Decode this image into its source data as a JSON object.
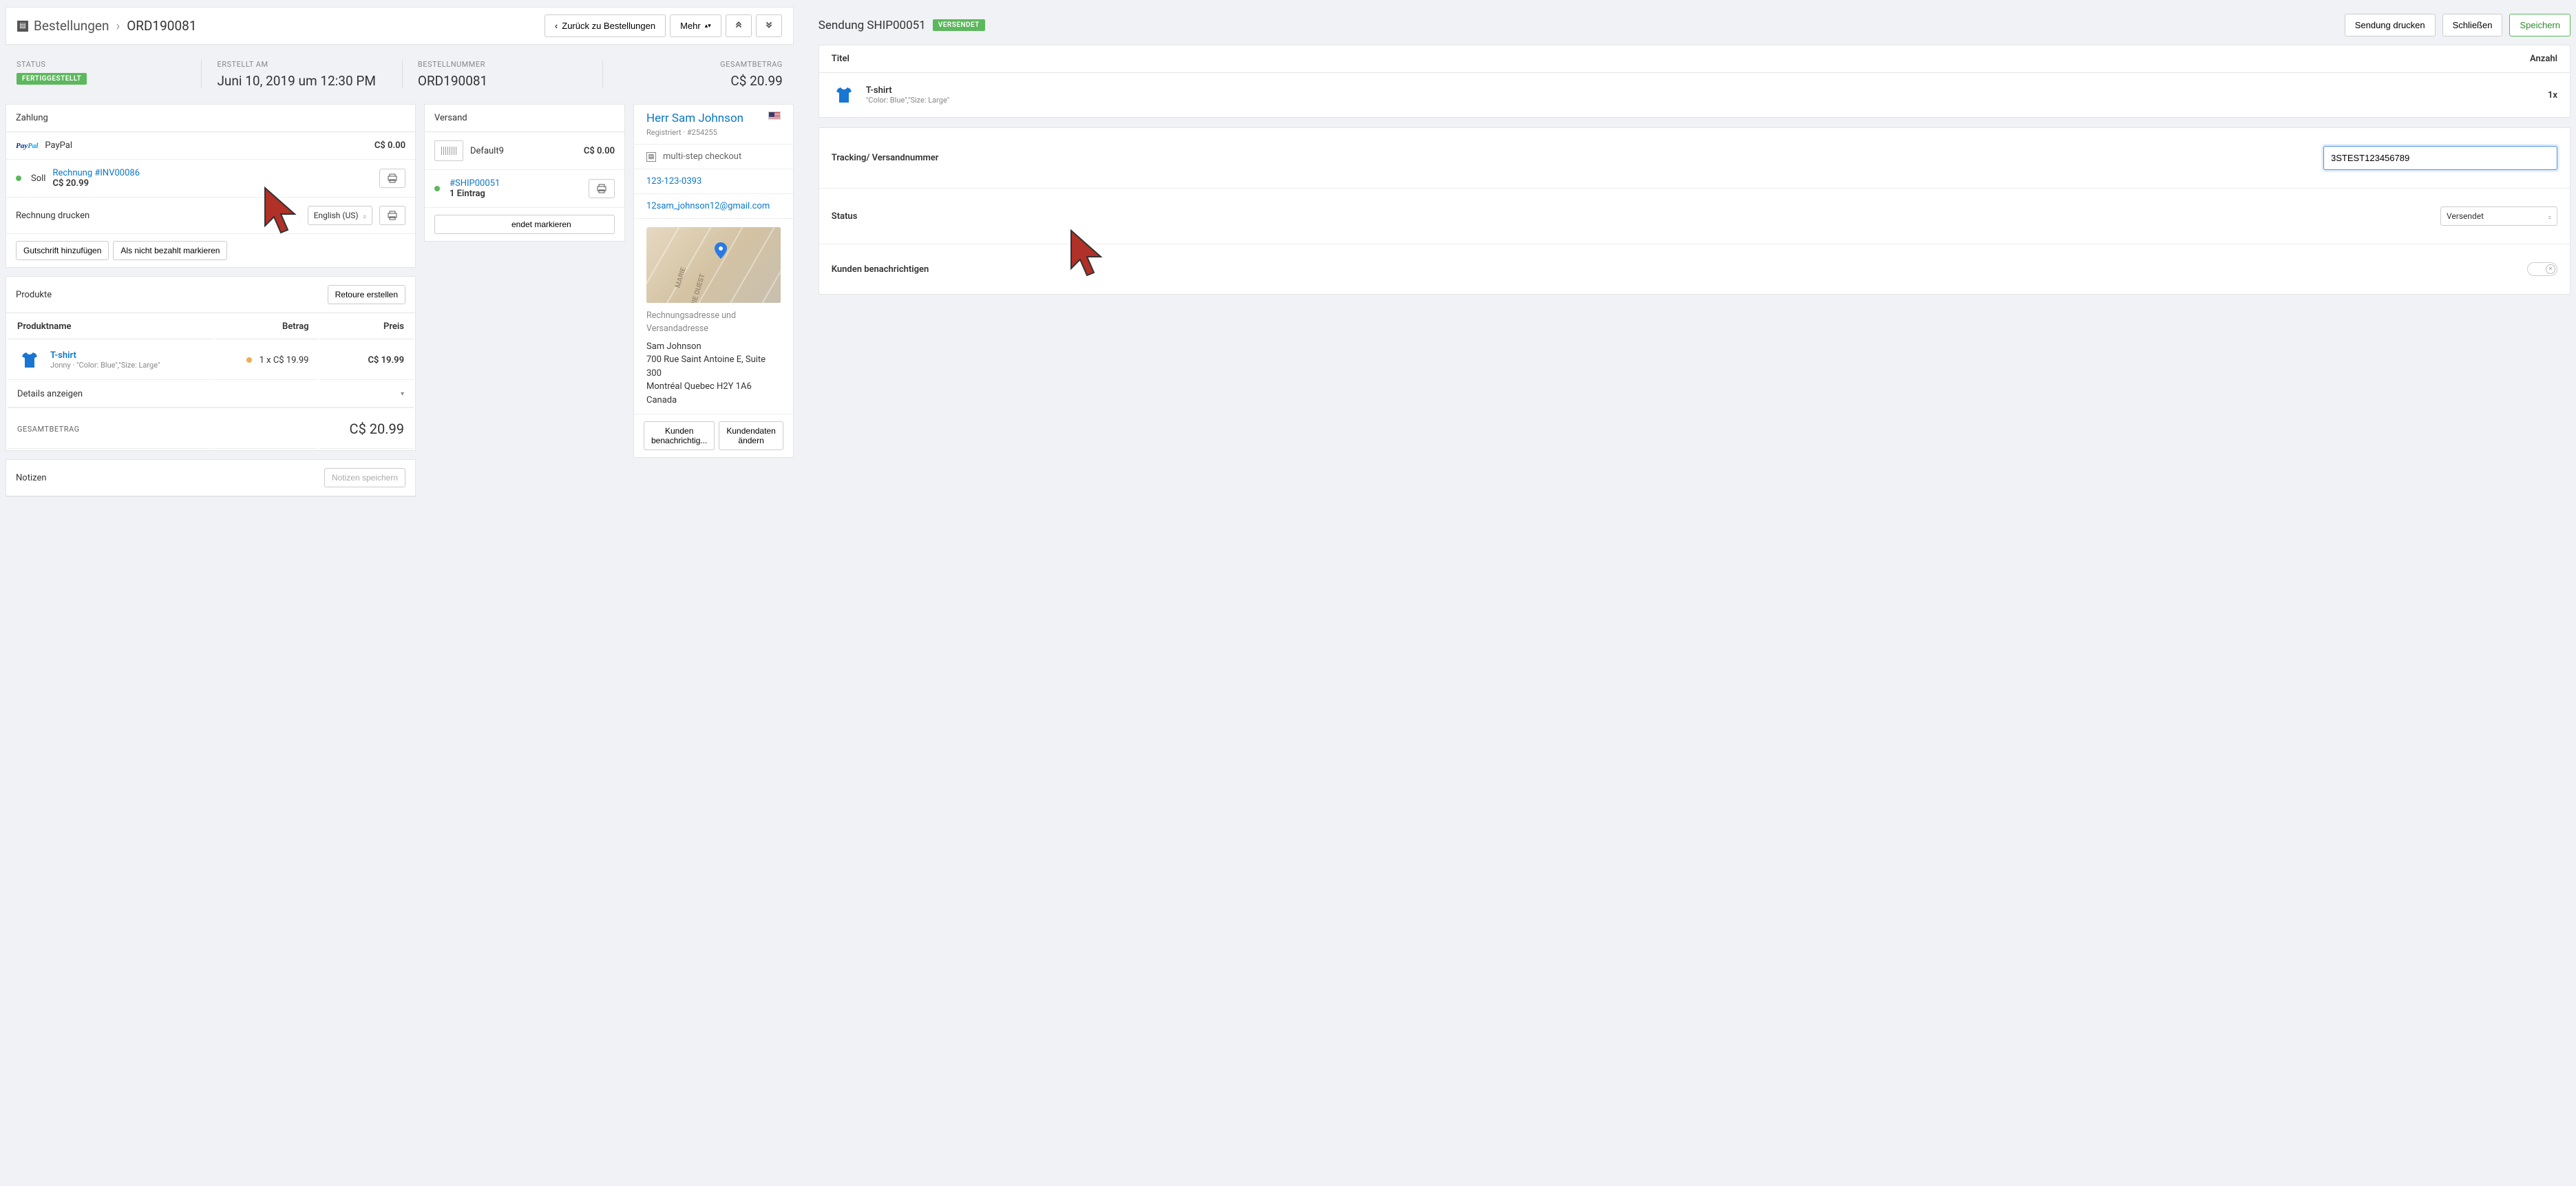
{
  "breadcrumb": {
    "root": "Bestellungen",
    "current": "ORD190081"
  },
  "header_actions": {
    "back": "Zurück zu Bestellungen",
    "more": "Mehr"
  },
  "summary": {
    "status_label": "STATUS",
    "status_badge": "FERTIGGESTELLT",
    "created_label": "ERSTELLT AM",
    "created_value": "Juni 10, 2019 um 12:30 PM",
    "ordernum_label": "BESTELLNUMMER",
    "ordernum_value": "ORD190081",
    "total_label": "GESAMTBETRAG",
    "total_value": "C$ 20.99"
  },
  "payment": {
    "title": "Zahlung",
    "method": "PayPal",
    "method_amount": "C$ 0.00",
    "soll_label": "Soll",
    "invoice_link": "Rechnung #INV00086",
    "invoice_amount": "C$ 20.99",
    "print_label": "Rechnung drucken",
    "locale": "English (US)",
    "add_credit": "Gutschrift hinzufügen",
    "mark_unpaid": "Als nicht bezahlt markieren"
  },
  "shipping": {
    "title": "Versand",
    "profile": "Default9",
    "profile_amount": "C$ 0.00",
    "ship_link": "#SHIP00051",
    "entries": "1 Eintrag",
    "mark_shipped_suffix": "endet markieren"
  },
  "customer": {
    "name": "Herr Sam Johnson",
    "registered": "Registriert · #254255",
    "checkout": "multi-step checkout",
    "phone": "123-123-0393",
    "email": "12sam_johnson12@gmail.com",
    "addr_label": "Rechnungsadresse und Versandadresse",
    "addr_name": "Sam Johnson",
    "addr_line1": "700 Rue Saint Antoine E, Suite 300",
    "addr_line2": "Montréal Quebec H2Y 1A6",
    "addr_country": "Canada",
    "map_text1": "MARIE",
    "map_text2": "RIE OUEST",
    "notify": "Kunden benachrichtig...",
    "edit": "Kundendaten ändern"
  },
  "products": {
    "title": "Produkte",
    "return_btn": "Retoure erstellen",
    "col_name": "Produktname",
    "col_amount": "Betrag",
    "col_price": "Preis",
    "item_name": "T-shirt",
    "item_meta": "Jonny · \"Color: Blue\",\"Size: Large\"",
    "item_qty": "1 x C$ 19.99",
    "item_price": "C$ 19.99",
    "details": "Details anzeigen",
    "total_label": "GESAMTBETRAG",
    "total_value": "C$ 20.99"
  },
  "notes": {
    "title": "Notizen",
    "save": "Notizen speichern"
  },
  "shipment": {
    "title": "Sendung SHIP00051",
    "badge": "VERSENDET",
    "print": "Sendung drucken",
    "close": "Schließen",
    "save": "Speichern",
    "col_title": "Titel",
    "col_qty": "Anzahl",
    "item_name": "T-shirt",
    "item_meta": "\"Color: Blue\",\"Size: Large\"",
    "item_qty": "1x",
    "tracking_label": "Tracking/ Versandnummer",
    "tracking_value": "3STEST123456789",
    "status_label": "Status",
    "status_value": "Versendet",
    "notify_label": "Kunden benachrichtigen"
  }
}
